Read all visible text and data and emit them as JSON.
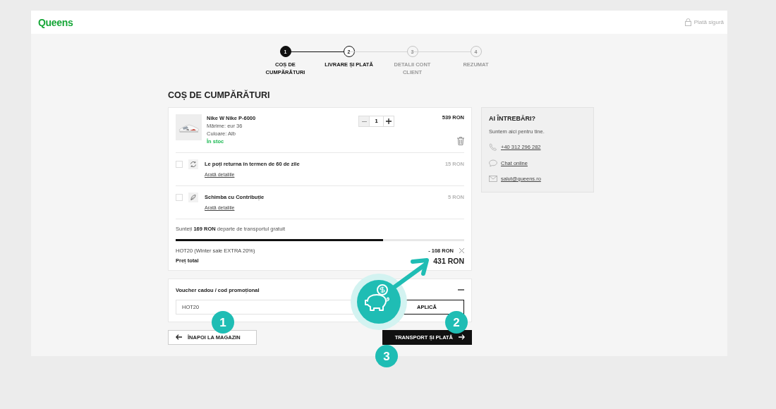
{
  "header": {
    "logo": "Queens",
    "secure_label": "Plată sigură"
  },
  "steps": [
    {
      "number": "1",
      "label": "COȘ DE CUMPĂRĂTURI",
      "selected": true,
      "reached": true
    },
    {
      "number": "2",
      "label": "LIVRARE ȘI PLATĂ",
      "selected": false,
      "reached": true
    },
    {
      "number": "3",
      "label": "DETALII CONT CLIENT",
      "selected": false,
      "reached": false
    },
    {
      "number": "4",
      "label": "REZUMAT",
      "selected": false,
      "reached": false
    }
  ],
  "cart": {
    "title": "COȘ DE CUMPĂRĂTURI",
    "product": {
      "name": "Nike W Nike P-6000",
      "attributes": [
        "Mărime: eur 36",
        "Culoare: Alb"
      ],
      "stock": "În stoc",
      "quantity": "1",
      "price": "539 RON"
    },
    "addons": [
      {
        "kind": "return",
        "label": "Le poți returna în termen de 60 de zile",
        "link": "Arată detaliile",
        "price": "15 RON",
        "checked": false
      },
      {
        "kind": "leaf",
        "label": "Schimba cu Contribuție",
        "link": "Arată detaliile",
        "price": "5 RON",
        "checked": false
      }
    ],
    "shipping_note": "Sunteți **169 RON** departe de transportul gratuit",
    "shipping_progress": {
      "level": 0.72
    },
    "discount": {
      "label": "HOT20 (Winter sale EXTRA 20%)",
      "amount": "- 108 RON"
    },
    "total": {
      "label": "Preț total",
      "value": "431 RON"
    }
  },
  "voucher": {
    "title": "Voucher cadou / cod promoțional",
    "expanded": true,
    "value": "HOT20",
    "apply": "APLICĂ"
  },
  "actions": {
    "back": "ÎNAPOI LA MAGAZIN",
    "continue": "TRANSPORT ȘI PLATĂ"
  },
  "help": {
    "title": "AI ÎNTREBĂRI?",
    "text": "Suntem aici pentru tine.",
    "contacts": [
      {
        "kind": "phone",
        "text": "+40 312 296 282"
      },
      {
        "kind": "chat",
        "text": "Chat online"
      },
      {
        "kind": "mail",
        "text": "salut@queens.ro"
      }
    ]
  },
  "annotations": [
    {
      "number": "1"
    },
    {
      "number": "2"
    },
    {
      "number": "3"
    }
  ]
}
